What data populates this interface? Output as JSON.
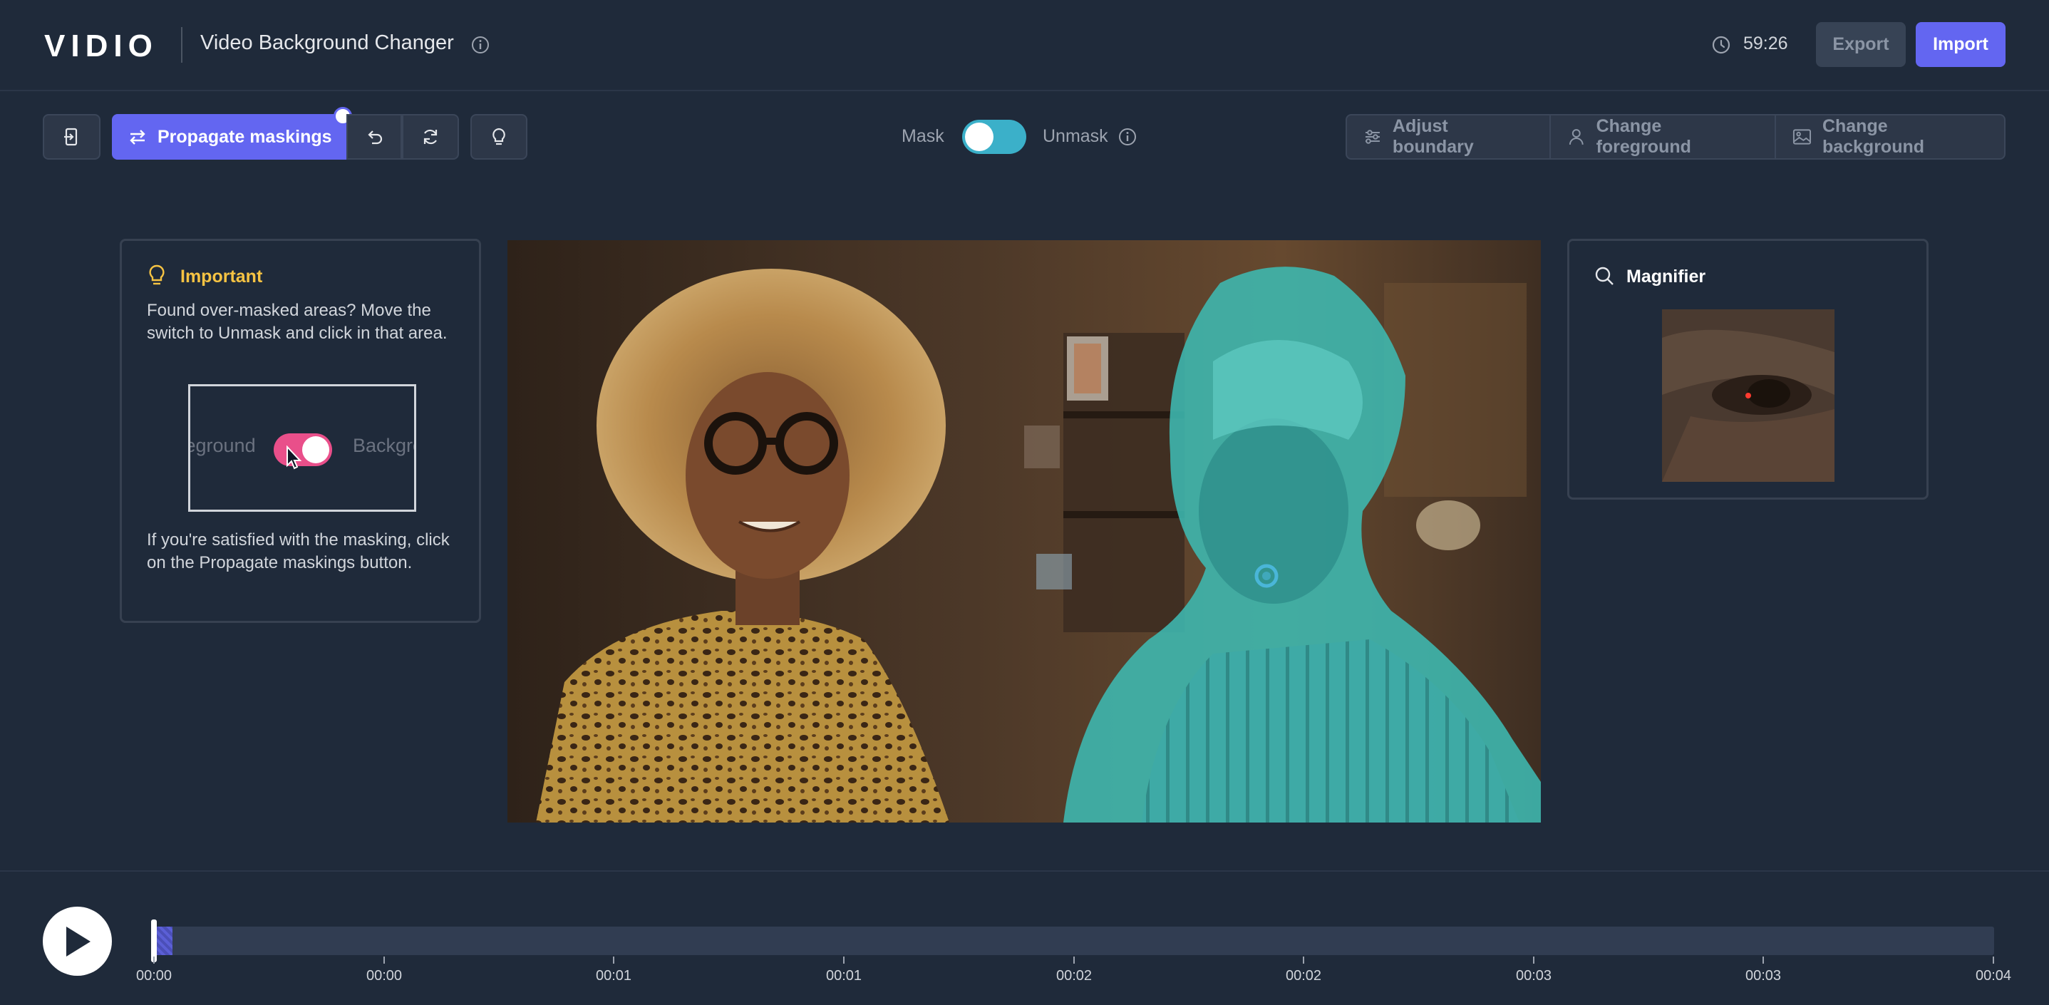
{
  "header": {
    "logo": "VIDIO",
    "title": "Video Background Changer",
    "timer": "59:26",
    "export_label": "Export",
    "import_label": "Import"
  },
  "toolbar": {
    "propagate_label": "Propagate maskings",
    "mask_label": "Mask",
    "unmask_label": "Unmask",
    "mask_toggle_state": "mask",
    "adjust_boundary_label": "Adjust boundary",
    "change_foreground_label": "Change foreground",
    "change_background_label": "Change background"
  },
  "tip": {
    "heading": "Important",
    "text1": "Found over-masked areas? Move the switch to Unmask and click in that area.",
    "demo_left": "Foreground",
    "demo_right": "Background",
    "text2": "If you're satisfied with the masking, click on the Propagate maskings button."
  },
  "magnifier": {
    "title": "Magnifier"
  },
  "timeline": {
    "ticks": [
      "00:00",
      "00:00",
      "00:01",
      "00:01",
      "00:02",
      "00:02",
      "00:03",
      "00:03",
      "00:04"
    ],
    "progress": 0.01
  },
  "colors": {
    "accent": "#6366f1",
    "mask_overlay": "#3cc4c4",
    "warning": "#f6c343",
    "toggle_pink": "#e94f8a"
  }
}
